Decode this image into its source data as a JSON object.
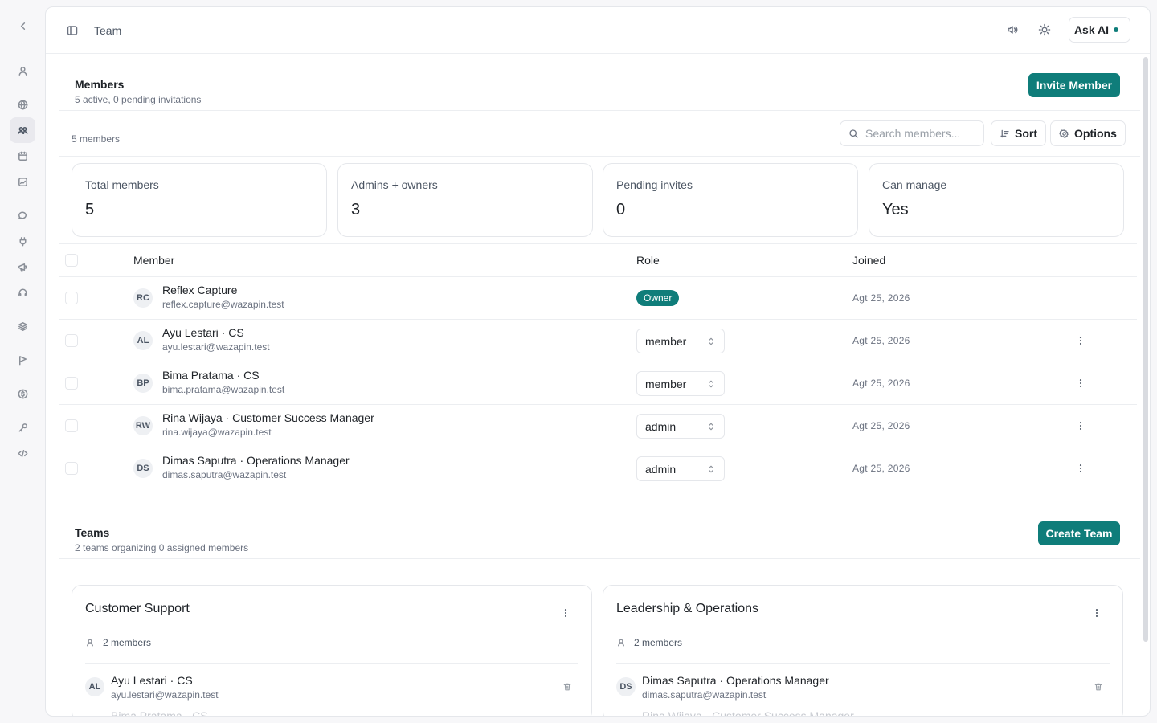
{
  "topbar": {
    "title": "Team",
    "ask_ai_label": "Ask AI"
  },
  "members_section": {
    "title": "Members",
    "subtitle": "5 active, 0 pending invitations",
    "invite_button": "Invite Member",
    "count_label": "5 members",
    "search_placeholder": "Search members...",
    "sort_label": "Sort",
    "options_label": "Options"
  },
  "stats": [
    {
      "label": "Total members",
      "value": "5"
    },
    {
      "label": "Admins + owners",
      "value": "3"
    },
    {
      "label": "Pending invites",
      "value": "0"
    },
    {
      "label": "Can manage",
      "value": "Yes"
    }
  ],
  "table": {
    "headers": {
      "member": "Member",
      "role": "Role",
      "joined": "Joined"
    },
    "rows": [
      {
        "initials": "RC",
        "name": "Reflex Capture",
        "email": "reflex.capture@wazapin.test",
        "role": "Owner",
        "joined": "Agt 25, 2026"
      },
      {
        "initials": "AL",
        "name": "Ayu Lestari · CS",
        "email": "ayu.lestari@wazapin.test",
        "role": "member",
        "joined": "Agt 25, 2026"
      },
      {
        "initials": "BP",
        "name": "Bima Pratama · CS",
        "email": "bima.pratama@wazapin.test",
        "role": "member",
        "joined": "Agt 25, 2026"
      },
      {
        "initials": "RW",
        "name": "Rina Wijaya · Customer Success Manager",
        "email": "rina.wijaya@wazapin.test",
        "role": "admin",
        "joined": "Agt 25, 2026"
      },
      {
        "initials": "DS",
        "name": "Dimas Saputra · Operations Manager",
        "email": "dimas.saputra@wazapin.test",
        "role": "admin",
        "joined": "Agt 25, 2026"
      }
    ]
  },
  "teams_section": {
    "title": "Teams",
    "subtitle": "2 teams organizing 0 assigned members",
    "create_button": "Create Team",
    "teams": [
      {
        "name": "Customer Support",
        "count": "2 members",
        "member": {
          "initials": "AL",
          "name": "Ayu Lestari · CS",
          "email": "ayu.lestari@wazapin.test"
        },
        "next_member": "Bima Pratama · CS"
      },
      {
        "name": "Leadership & Operations",
        "count": "2 members",
        "member": {
          "initials": "DS",
          "name": "Dimas Saputra · Operations Manager",
          "email": "dimas.saputra@wazapin.test"
        },
        "next_member": "Rina Wijaya · Customer Success Manager"
      }
    ]
  },
  "colors": {
    "accent": "#0f7d7a",
    "border": "#e5e7eb",
    "muted_text": "#6b7280"
  }
}
